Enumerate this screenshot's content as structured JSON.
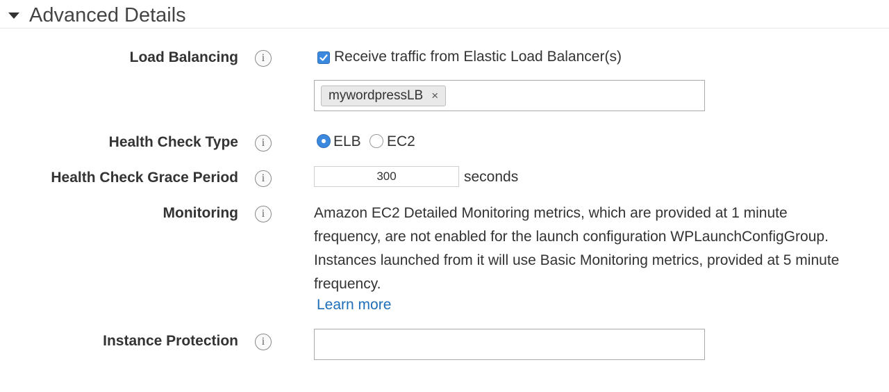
{
  "section": {
    "title": "Advanced Details"
  },
  "info_icon_glyph": "i",
  "load_balancing": {
    "label": "Load Balancing",
    "checkbox_label": "Receive traffic from Elastic Load Balancer(s)",
    "checked": true,
    "tokens": [
      {
        "label": "mywordpressLB",
        "remove_glyph": "×"
      }
    ]
  },
  "health_check_type": {
    "label": "Health Check Type",
    "options": [
      {
        "label": "ELB",
        "selected": true
      },
      {
        "label": "EC2",
        "selected": false
      }
    ]
  },
  "health_check_grace_period": {
    "label": "Health Check Grace Period",
    "value": "300",
    "unit": "seconds"
  },
  "monitoring": {
    "label": "Monitoring",
    "lines": [
      "Amazon EC2 Detailed Monitoring metrics, which are provided at 1 minute",
      "frequency, are not enabled for the launch configuration WPLaunchConfigGroup.",
      "Instances launched from it will use Basic Monitoring metrics, provided at 5 minute",
      "frequency."
    ],
    "learn_more": "Learn more"
  },
  "instance_protection": {
    "label": "Instance Protection",
    "value": ""
  },
  "colors": {
    "accent": "#3b89de",
    "link": "#1e6eb8",
    "text": "#333333"
  }
}
